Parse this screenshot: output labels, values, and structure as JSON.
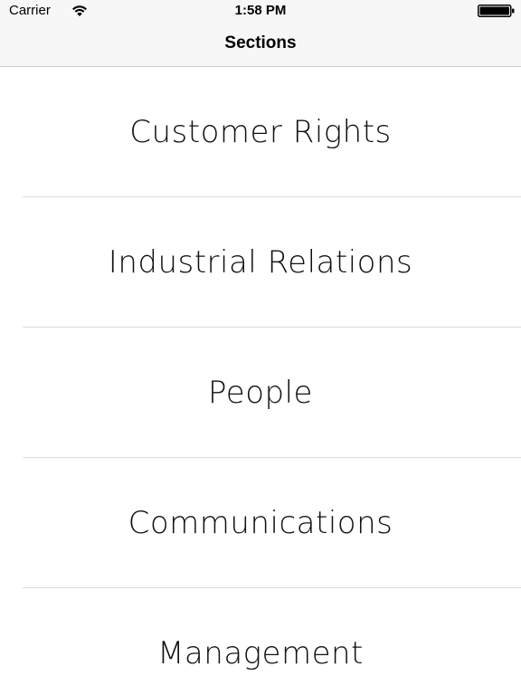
{
  "status_bar": {
    "carrier": "Carrier",
    "time": "1:58 PM",
    "wifi_icon": "wifi-icon",
    "battery_icon": "battery-icon"
  },
  "nav": {
    "title": "Sections"
  },
  "sections": [
    {
      "label": "Customer Rights"
    },
    {
      "label": "Industrial Relations"
    },
    {
      "label": "People"
    },
    {
      "label": "Communications"
    },
    {
      "label": "Management"
    }
  ],
  "colors": {
    "bar_background": "#f7f7f7",
    "separator": "#dddddd",
    "text": "#000000"
  }
}
